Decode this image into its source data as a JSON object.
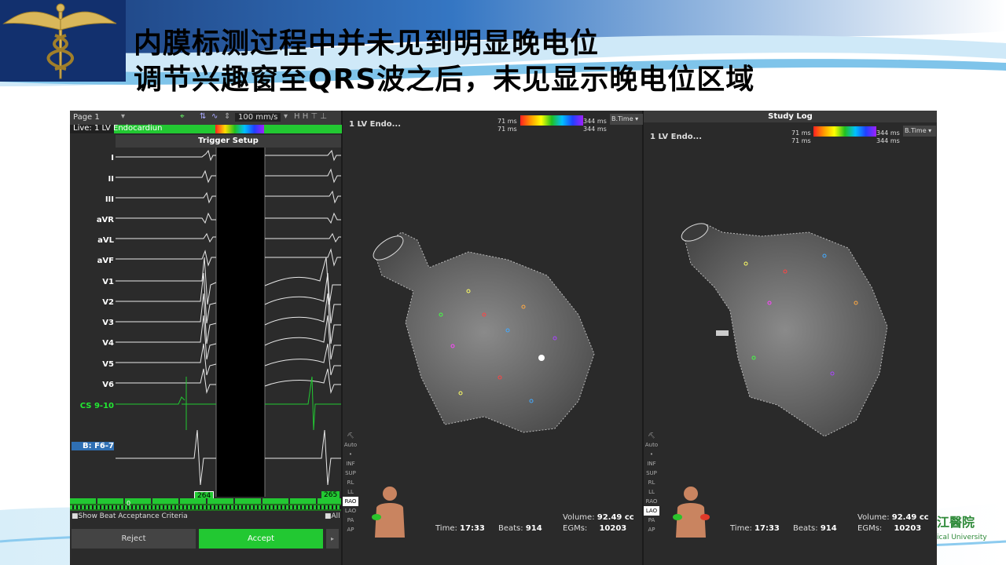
{
  "slide": {
    "title_line1": "内膜标测过程中并未见到明显晚电位",
    "title_line2": "调节兴趣窗至QRS波之后，未见显示晚电位区域",
    "footer_logo_text": "江醫院",
    "footer_logo_sub": "ical University"
  },
  "ecg_panel": {
    "page_label": "Page 1",
    "speed": "100 mm/s",
    "live_label": "Live: 1 LV Endocardiun",
    "trigger_setup": "Trigger Setup",
    "leads": [
      "I",
      "II",
      "III",
      "aVR",
      "aVL",
      "aVF",
      "V1",
      "V2",
      "V3",
      "V4",
      "V5",
      "V6",
      "CS 9-10",
      "B: F6-7"
    ],
    "rv_badge": "R V",
    "window_value_left": "264",
    "window_value_right": "265",
    "beat_counter": "0",
    "show_beat_acceptance": "Show Beat Acceptance Criteria",
    "all_label": "All",
    "reject_label": "Reject",
    "accept_label": "Accept"
  },
  "map_left": {
    "title": "1 LV Endo...",
    "scale_top_left": "71 ms",
    "scale_bottom_left": "71 ms",
    "scale_top_right": "344 ms",
    "scale_bottom_right": "344 ms",
    "mode": "B.Time",
    "view_buttons": [
      "Auto",
      "•",
      "INF",
      "SUP",
      "RL",
      "LL",
      "RAO",
      "LAO",
      "PA",
      "AP"
    ],
    "active_view": "RAO",
    "time_label": "Time:",
    "time_value": "17:33",
    "beats_label": "Beats:",
    "beats_value": "914",
    "volume_label": "Volume:",
    "volume_value": "92.49 cc",
    "egms_label": "EGMs:",
    "egms_value": "10203"
  },
  "map_right": {
    "header": "Study Log",
    "title": "1 LV Endo...",
    "scale_top_left": "71 ms",
    "scale_bottom_left": "71 ms",
    "scale_top_right": "344 ms",
    "scale_bottom_right": "344 ms",
    "mode": "B.Time",
    "view_buttons": [
      "Auto",
      "•",
      "INF",
      "SUP",
      "RL",
      "LL",
      "RAO",
      "LAO",
      "PA",
      "AP"
    ],
    "active_view": "LAO",
    "time_label": "Time:",
    "time_value": "17:33",
    "beats_label": "Beats:",
    "beats_value": "914",
    "volume_label": "Volume:",
    "volume_value": "92.49 cc",
    "egms_label": "EGMs:",
    "egms_value": "10203"
  },
  "colors": {
    "slide_blue": "#1e4f9a",
    "sky_blue": "#bfe3f7",
    "ecg_green": "#22c832",
    "label_blue": "#2f6fb3",
    "panel_dark": "#2a2a2a"
  }
}
